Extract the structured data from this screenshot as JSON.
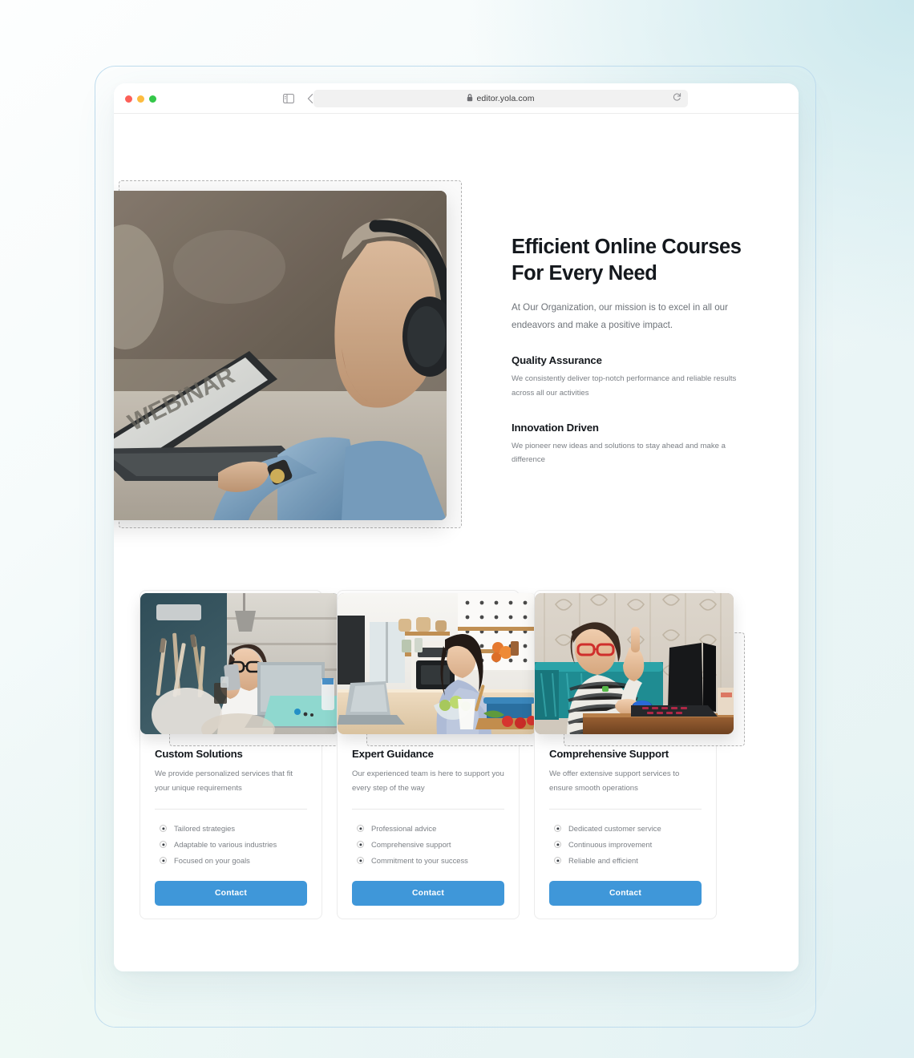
{
  "browser": {
    "traffic_lights": [
      "close",
      "minimize",
      "maximize"
    ],
    "url": "editor.yola.com",
    "lock_glyph": "\u0000",
    "icons": [
      "sidebar-icon",
      "back-icon",
      "forward-icon",
      "shield-icon",
      "lock-icon",
      "reload-icon",
      "download-icon",
      "new-tab-icon",
      "tab-overview-icon"
    ]
  },
  "hero": {
    "title": "Efficient Online Courses For Every Need",
    "subtitle": "At Our Organization, our mission is to excel in all our endeavors and make a positive impact.",
    "image_alt": "Man wearing headphones working at a laptop displaying a webinar",
    "features": [
      {
        "title": "Quality Assurance",
        "body": "We consistently deliver top-notch performance and reliable results across all our activities"
      },
      {
        "title": "Innovation Driven",
        "body": "We pioneer new ideas and solutions to stay ahead and make a difference"
      }
    ]
  },
  "cards": [
    {
      "title": "Custom Solutions",
      "description": "We provide personalized services that fit your unique requirements",
      "image_alt": "Woman with glasses holding a phone at a desk with a laptop and paintbrushes",
      "bullets": [
        "Tailored strategies",
        "Adaptable to various industries",
        "Focused on your goals"
      ],
      "button_label": "Contact"
    },
    {
      "title": "Expert Guidance",
      "description": "Our experienced team is here to support you every step of the way",
      "image_alt": "Woman cooking in a bright kitchen beside an open laptop",
      "bullets": [
        "Professional advice",
        "Comprehensive support",
        "Commitment to your success"
      ],
      "button_label": "Contact"
    },
    {
      "title": "Comprehensive Support",
      "description": "We offer extensive support services to ensure smooth operations",
      "image_alt": "Boy with red glasses raising his hand in front of a laptop",
      "bullets": [
        "Dedicated customer service",
        "Continuous improvement",
        "Reliable and efficient"
      ],
      "button_label": "Contact"
    }
  ],
  "colors": {
    "accent": "#3f97d9",
    "heading": "#14181d",
    "body_text": "#7c8086",
    "frame_border": "#bfdcee",
    "placeholder_border": "#b4b4b4",
    "card_border": "#ececec"
  }
}
